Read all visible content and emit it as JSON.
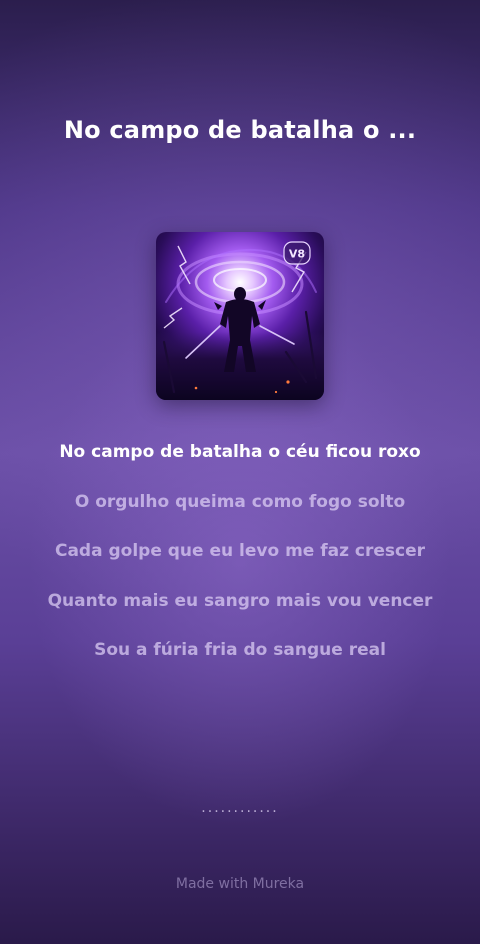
{
  "song": {
    "title": "No campo de batalha o ...",
    "cover_badge": "V8"
  },
  "lyrics": [
    {
      "text": "No campo de batalha o céu ficou roxo",
      "active": true
    },
    {
      "text": "O orgulho queima como fogo solto",
      "active": false
    },
    {
      "text": "Cada golpe que eu levo me faz crescer",
      "active": false
    },
    {
      "text": "Quanto mais eu sangro mais vou vencer",
      "active": false
    },
    {
      "text": "Sou a fúria fria do sangue real",
      "active": false
    }
  ],
  "loading_dots": "............",
  "footer": "Made with Mureka",
  "colors": {
    "background_top": "#2b1e4d",
    "background_mid": "#6a4fa6",
    "background_bottom": "#2a1a4a",
    "active_lyric": "#ffffff",
    "inactive_lyric": "#d9c9f0"
  },
  "icons": {
    "cover_art": "warrior-storm-cover-image"
  }
}
